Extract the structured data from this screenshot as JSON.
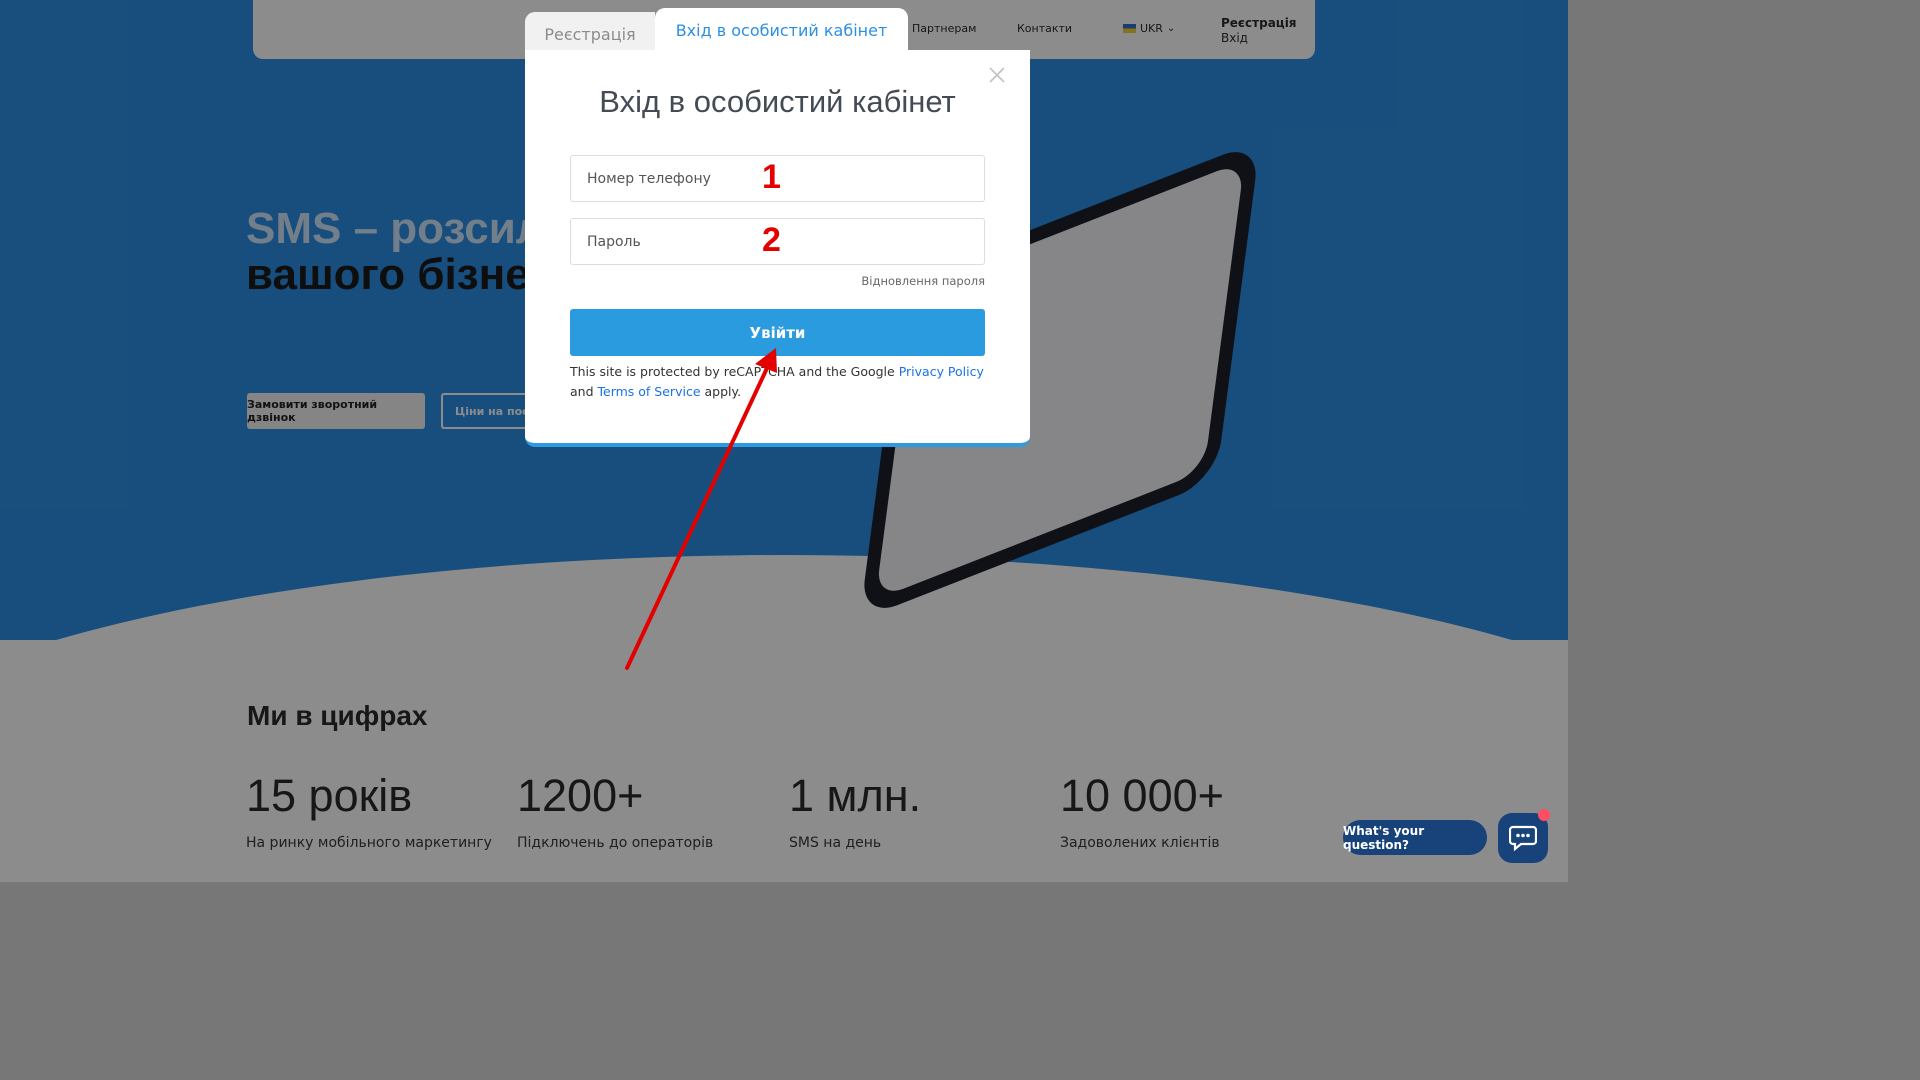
{
  "nav": {
    "partners": "Партнерам",
    "contacts": "Контакти",
    "lang": "UKR",
    "register": "Реєстрація",
    "login": "Вхід"
  },
  "hero": {
    "title_line1": "SMS – розсил",
    "title_line2": "вашого бізнес",
    "callback_button": "Замовити зворотний дзвінок",
    "prices_button": "Ціни на послу"
  },
  "stats": {
    "title": "Ми в цифрах",
    "items": [
      {
        "value": "15 років",
        "label": "На ринку мобільного маркетингу"
      },
      {
        "value": "1200+",
        "label": "Підключень до операторів"
      },
      {
        "value": "1 млн.",
        "label": "SMS на день"
      },
      {
        "value": "10 000+",
        "label": "Задоволених клієнтів"
      }
    ]
  },
  "chat": {
    "bubble_text": "What's your question?"
  },
  "modal": {
    "tabs": [
      {
        "label": "Реєстрація",
        "active": false
      },
      {
        "label": "Вхід в особистий кабінет",
        "active": true
      }
    ],
    "title": "Вхід в особистий кабінет",
    "phone_placeholder": "Номер телефону",
    "password_placeholder": "Пароль",
    "forgot_password": "Відновлення пароля",
    "submit_label": "Увійти",
    "recaptcha": {
      "text_before": "This site is protected by reCAPTCHA and the Google ",
      "privacy_link": "Privacy Policy",
      "text_and": " and ",
      "terms_link": "Terms of Service",
      "text_after": " apply."
    }
  },
  "annotations": {
    "mark1": "1",
    "mark2": "2"
  },
  "colors": {
    "hero_blue": "#2b8fe3",
    "button_blue": "#2b9bdf",
    "link_blue": "#1a73e8",
    "annotation_red": "#e50000",
    "chat_navy": "#17427a"
  }
}
